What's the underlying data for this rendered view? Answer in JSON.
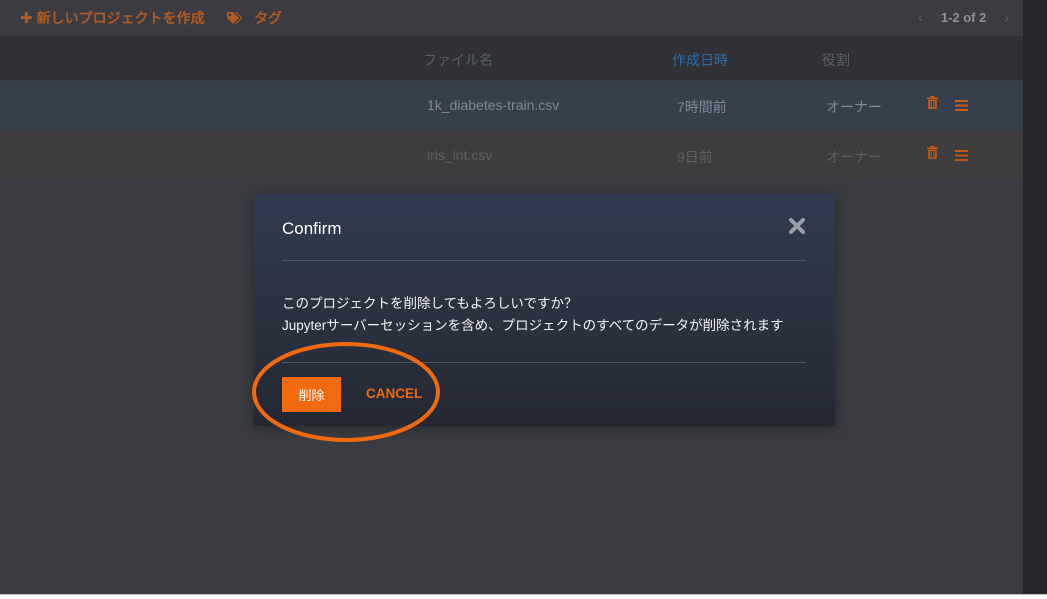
{
  "toolbar": {
    "new_project_label": "新しいプロジェクトを作成",
    "tag_label": "タグ",
    "pagination": "1-2 of 2"
  },
  "table": {
    "columns": {
      "filename": "ファイル名",
      "created": "作成日時",
      "role": "役割"
    },
    "sorted_column": "created",
    "rows": [
      {
        "filename": "1k_diabetes-train.csv",
        "created": "7時間前",
        "role": "オーナー"
      },
      {
        "filename": "iris_int.csv",
        "created": "9日前",
        "role": "オーナー"
      }
    ]
  },
  "dialog": {
    "title": "Confirm",
    "message_line1": "このプロジェクトを削除してもよろしいですか？",
    "message_line2": "Jupyterサーバーセッションを含め、プロジェクトのすべてのデータが削除されます",
    "delete_label": "削除",
    "cancel_label": "CANCEL"
  },
  "colors": {
    "accent": "#f26a10",
    "background": "#3a3c41",
    "modal": "#2b3342",
    "highlight_ring": "#f26a10"
  },
  "icons": {
    "new_project": "plus-icon",
    "tag": "tag-icon",
    "delete_row": "trash-icon",
    "row_menu": "hamburger-menu-icon",
    "close": "close-icon",
    "prev": "chevron-left-icon",
    "next": "chevron-right-icon"
  }
}
